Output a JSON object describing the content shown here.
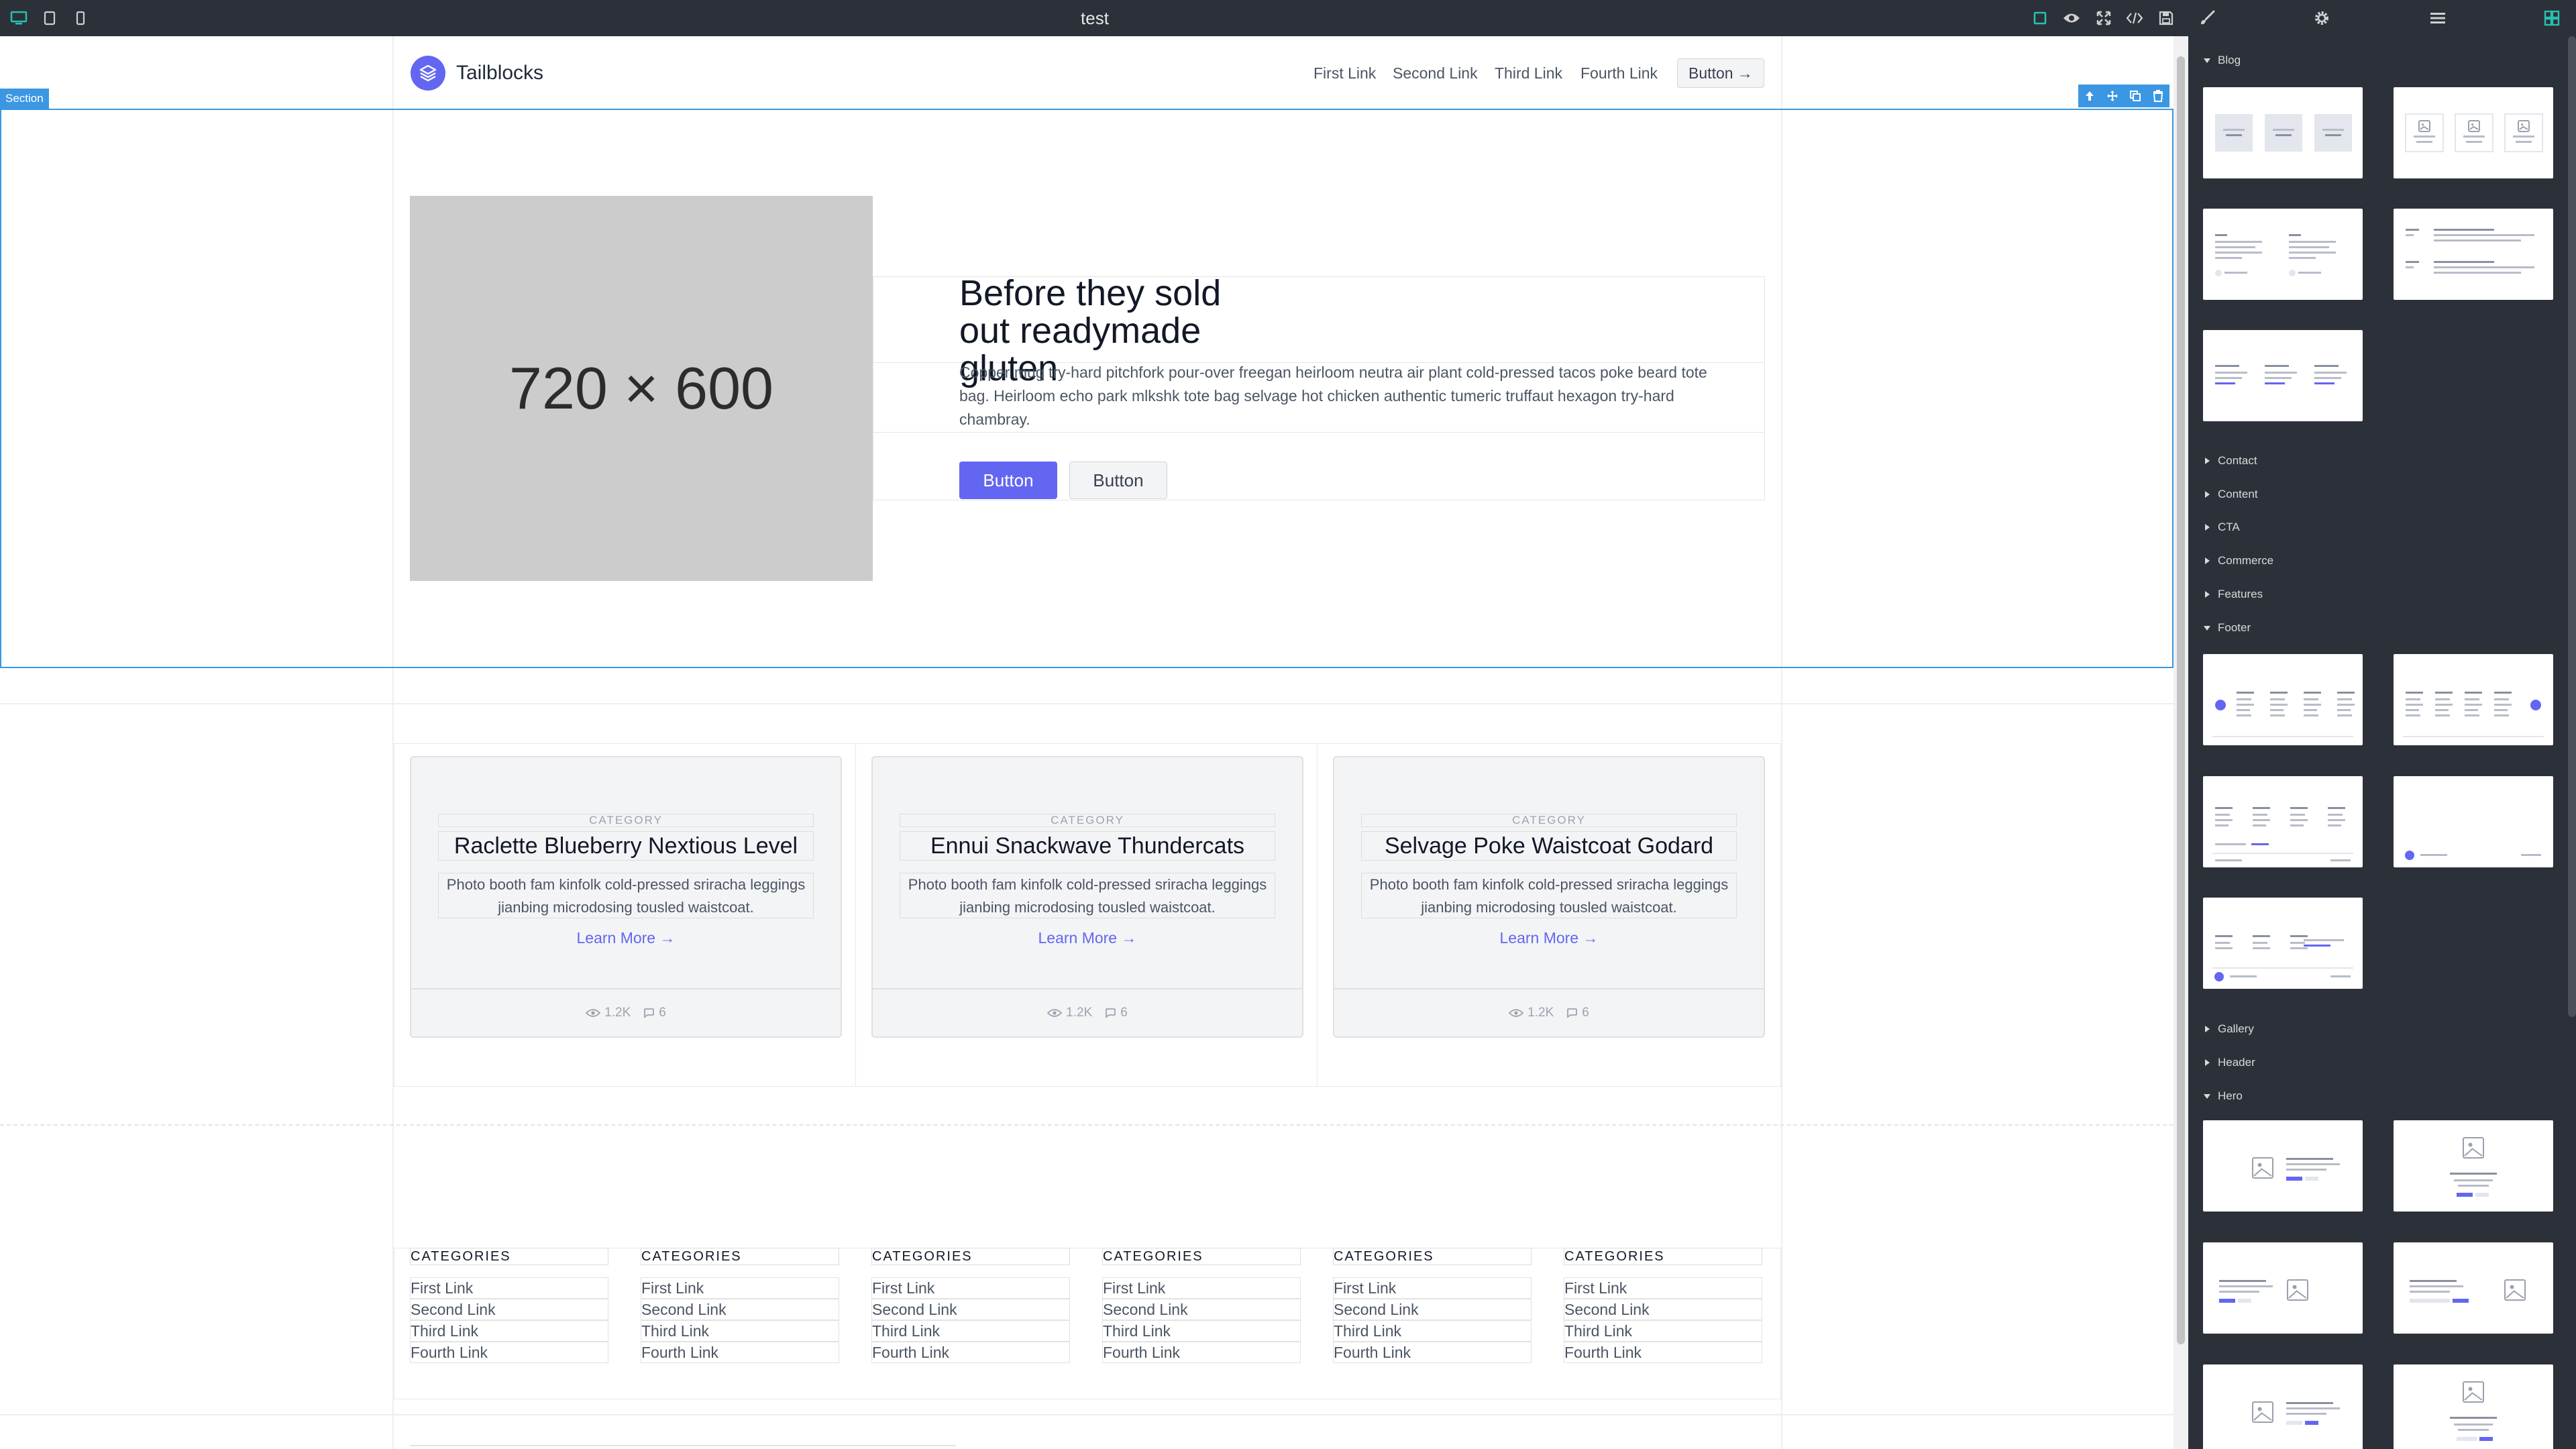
{
  "app": {
    "title": "test",
    "accent_color": "#3b97e3",
    "brand_color": "#6366f1"
  },
  "toolbar": {
    "left_icons": [
      "desktop-icon",
      "tablet-icon",
      "mobile-icon"
    ],
    "right_icons": [
      "outline-icon",
      "eye-icon",
      "fullscreen-icon",
      "code-icon",
      "save-icon",
      "paint-brush-icon",
      "gear-icon",
      "layers-icon",
      "blocks-icon"
    ]
  },
  "selection": {
    "badge": "Section",
    "tools": [
      "arrow-up-icon",
      "move-icon",
      "copy-icon",
      "trash-icon"
    ]
  },
  "page": {
    "nav": {
      "brand": "Tailblocks",
      "links": [
        "First Link",
        "Second Link",
        "Third Link",
        "Fourth Link"
      ],
      "button": "Button →"
    },
    "hero": {
      "image_label": "720 × 600",
      "title": "Before they sold out readymade gluten",
      "text": "Copper mug try-hard pitchfork pour-over freegan heirloom neutra air plant cold-pressed tacos poke beard tote bag. Heirloom echo park mlkshk tote bag selvage hot chicken authentic tumeric truffaut hexagon try-hard chambray.",
      "primary_button": "Button",
      "secondary_button": "Button"
    },
    "blog": {
      "cards": [
        {
          "category": "CATEGORY",
          "title": "Raclette Blueberry Nextious Level",
          "text": "Photo booth fam kinfolk cold-pressed sriracha leggings jianbing microdosing tousled waistcoat.",
          "link": "Learn More →",
          "views": "1.2K",
          "comments": "6"
        },
        {
          "category": "CATEGORY",
          "title": "Ennui Snackwave Thundercats",
          "text": "Photo booth fam kinfolk cold-pressed sriracha leggings jianbing microdosing tousled waistcoat.",
          "link": "Learn More →",
          "views": "1.2K",
          "comments": "6"
        },
        {
          "category": "CATEGORY",
          "title": "Selvage Poke Waistcoat Godard",
          "text": "Photo booth fam kinfolk cold-pressed sriracha leggings jianbing microdosing tousled waistcoat.",
          "link": "Learn More →",
          "views": "1.2K",
          "comments": "6"
        }
      ]
    },
    "footer": {
      "columns": [
        {
          "heading": "CATEGORIES",
          "links": [
            "First Link",
            "Second Link",
            "Third Link",
            "Fourth Link"
          ]
        },
        {
          "heading": "CATEGORIES",
          "links": [
            "First Link",
            "Second Link",
            "Third Link",
            "Fourth Link"
          ]
        },
        {
          "heading": "CATEGORIES",
          "links": [
            "First Link",
            "Second Link",
            "Third Link",
            "Fourth Link"
          ]
        },
        {
          "heading": "CATEGORIES",
          "links": [
            "First Link",
            "Second Link",
            "Third Link",
            "Fourth Link"
          ]
        },
        {
          "heading": "CATEGORIES",
          "links": [
            "First Link",
            "Second Link",
            "Third Link",
            "Fourth Link"
          ]
        },
        {
          "heading": "CATEGORIES",
          "links": [
            "First Link",
            "Second Link",
            "Third Link",
            "Fourth Link"
          ]
        }
      ]
    }
  },
  "panel": {
    "categories": [
      {
        "label": "Blog",
        "expanded": true
      },
      {
        "label": "Contact",
        "expanded": false
      },
      {
        "label": "Content",
        "expanded": false
      },
      {
        "label": "CTA",
        "expanded": false
      },
      {
        "label": "Commerce",
        "expanded": false
      },
      {
        "label": "Features",
        "expanded": false
      },
      {
        "label": "Footer",
        "expanded": true
      },
      {
        "label": "Gallery",
        "expanded": false
      },
      {
        "label": "Header",
        "expanded": false
      },
      {
        "label": "Hero",
        "expanded": true
      }
    ]
  }
}
